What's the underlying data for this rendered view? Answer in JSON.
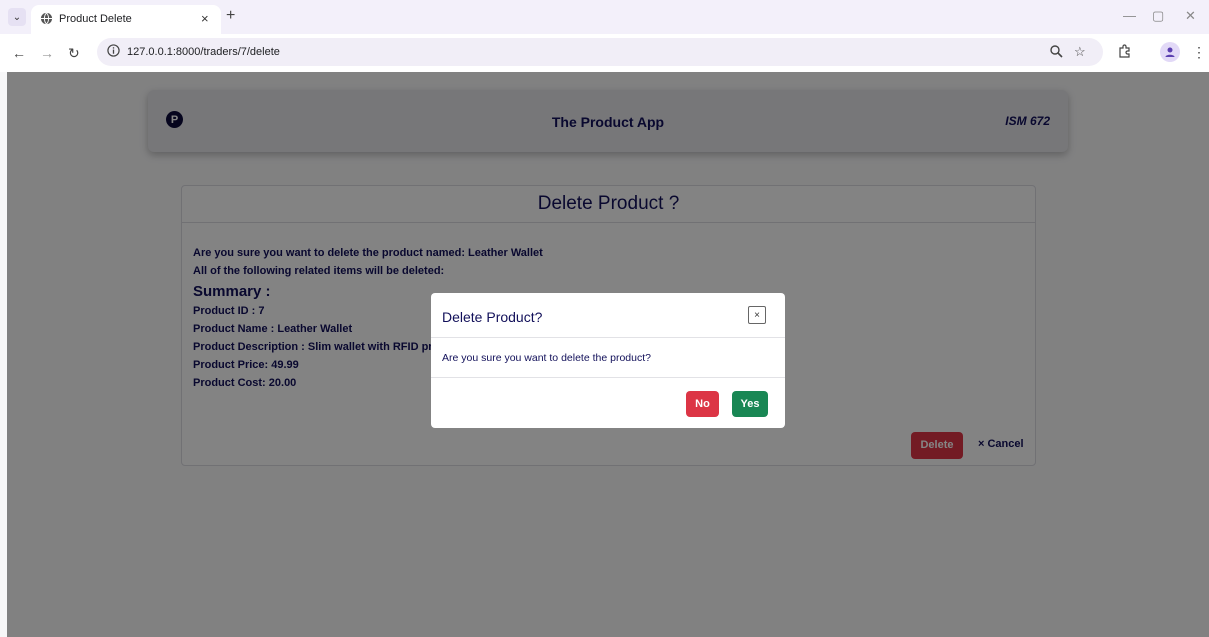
{
  "browser": {
    "tab_title": "Product Delete",
    "tab_close": "×",
    "new_tab": "+",
    "url": "127.0.0.1:8000/traders/7/delete",
    "win_min": "—",
    "win_restore": "▢",
    "win_close": "✕"
  },
  "navbar": {
    "logo_letter": "P",
    "brand": "The Product App",
    "course": "ISM 672"
  },
  "card": {
    "title": "Delete Product ?",
    "confirm_line": "Are you sure you want to delete the product named: Leather Wallet",
    "related_line": "All of the following related items will be deleted:",
    "summary_label": "Summary :",
    "product_id": "Product ID : 7",
    "product_name": "Product Name : Leather Wallet",
    "product_description": "Product Description : Slim wallet with RFID pr",
    "product_price": "Product Price: 49.99",
    "product_cost": "Product Cost: 20.00",
    "delete_label": "Delete",
    "cancel_label": "× Cancel"
  },
  "modal": {
    "title": "Delete Product?",
    "close_label": "×",
    "message": "Are you sure you want to delete the product?",
    "no_label": "No",
    "yes_label": "Yes"
  },
  "colors": {
    "primary_text": "#12105a",
    "danger": "#dc3545",
    "success": "#198754",
    "backdrop": "rgba(0,0,0,0.48)"
  },
  "icons": [
    "tab-search-icon",
    "globe-icon",
    "back-arrow-icon",
    "forward-arrow-icon",
    "reload-icon",
    "site-info-icon",
    "zoom-icon",
    "bookmark-star-icon",
    "extensions-icon",
    "profile-icon",
    "kebab-menu-icon"
  ]
}
